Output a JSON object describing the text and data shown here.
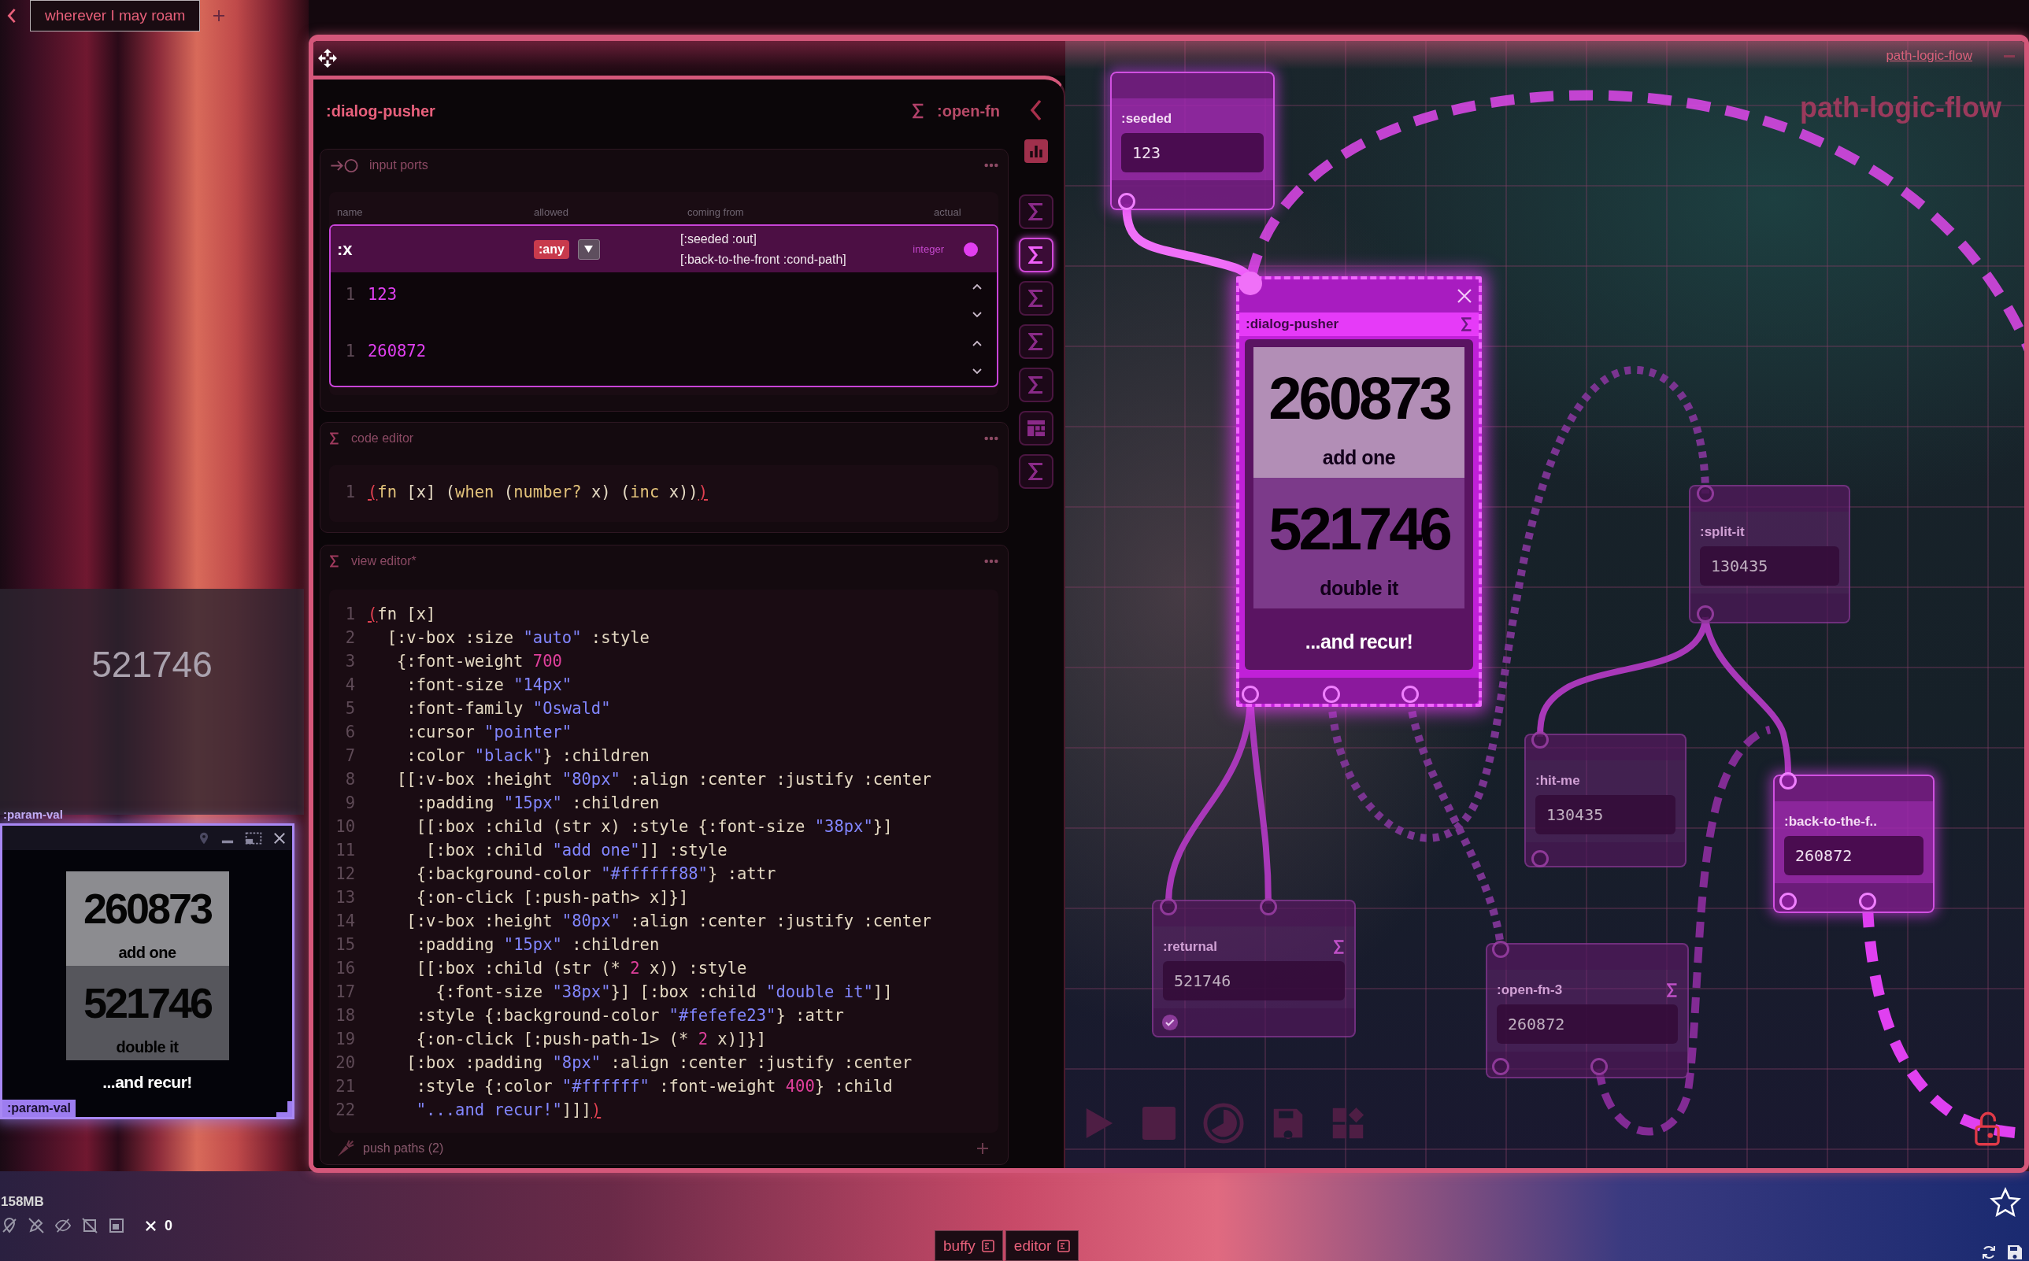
{
  "top_bar": {
    "tabs": [
      {
        "label": "wherever I may roam",
        "selected": true
      }
    ]
  },
  "preview": {
    "value": "521746"
  },
  "param_window": {
    "title": ":param-val",
    "view": {
      "boxes": [
        {
          "value": "260873",
          "caption": "add one"
        },
        {
          "value": "521746",
          "caption": "double it"
        }
      ],
      "footer": "...and recur!"
    },
    "badge": ":param-val"
  },
  "status": {
    "memory": "158MB",
    "error_count": "0"
  },
  "main_window": {
    "link": "path-logic-flow",
    "editor": {
      "title": ":dialog-pusher",
      "fn_name": ":open-fn",
      "side_buttons": [
        {
          "kind": "chart",
          "selected": false
        },
        {
          "kind": "sigma",
          "selected": false
        },
        {
          "kind": "sigma",
          "selected": true
        },
        {
          "kind": "sigma",
          "selected": false
        },
        {
          "kind": "sigma",
          "selected": false
        },
        {
          "kind": "sigma",
          "selected": false
        },
        {
          "kind": "layout",
          "selected": false
        },
        {
          "kind": "sigma",
          "selected": false
        }
      ],
      "input_ports": {
        "title": "input ports",
        "columns": [
          "name",
          "allowed",
          "coming from",
          "actual"
        ],
        "rows": [
          {
            "name": ":x",
            "allowed": ":any",
            "coming_from": [
              "[:seeded :out]",
              "[:back-to-the-front :cond-path]"
            ],
            "actual": "integer",
            "selected": true,
            "values": [
              {
                "line": "1",
                "text": "123"
              },
              {
                "line": "1",
                "text": "260872"
              }
            ]
          }
        ]
      },
      "code_editor": {
        "title": "code editor",
        "lines": [
          {
            "number": "1",
            "tokens": [
              {
                "kind": "match",
                "text": "("
              },
              {
                "kind": "symbol",
                "text": "fn"
              },
              {
                "kind": "plain",
                "text": " [x] ("
              },
              {
                "kind": "symbol",
                "text": "when"
              },
              {
                "kind": "plain",
                "text": " ("
              },
              {
                "kind": "symbol",
                "text": "number?"
              },
              {
                "kind": "plain",
                "text": " x) ("
              },
              {
                "kind": "symbol",
                "text": "inc"
              },
              {
                "kind": "plain",
                "text": " x))"
              },
              {
                "kind": "match",
                "text": ")"
              }
            ]
          }
        ]
      },
      "view_editor": {
        "title": "view editor*",
        "lines": [
          {
            "number": "1",
            "tokens": [
              {
                "kind": "match",
                "text": "("
              },
              {
                "kind": "plain",
                "text": "fn [x]"
              }
            ]
          },
          {
            "number": "2",
            "tokens": [
              {
                "kind": "plain",
                "text": "  [:v-box :size "
              },
              {
                "kind": "string",
                "text": "\"auto\""
              },
              {
                "kind": "plain",
                "text": " :style"
              }
            ]
          },
          {
            "number": "3",
            "tokens": [
              {
                "kind": "plain",
                "text": "   {:font-weight "
              },
              {
                "kind": "number",
                "text": "700"
              }
            ]
          },
          {
            "number": "4",
            "tokens": [
              {
                "kind": "plain",
                "text": "    :font-size "
              },
              {
                "kind": "string",
                "text": "\"14px\""
              }
            ]
          },
          {
            "number": "5",
            "tokens": [
              {
                "kind": "plain",
                "text": "    :font-family "
              },
              {
                "kind": "string",
                "text": "\"Oswald\""
              }
            ]
          },
          {
            "number": "6",
            "tokens": [
              {
                "kind": "plain",
                "text": "    :cursor "
              },
              {
                "kind": "string",
                "text": "\"pointer\""
              }
            ]
          },
          {
            "number": "7",
            "tokens": [
              {
                "kind": "plain",
                "text": "    :color "
              },
              {
                "kind": "string",
                "text": "\"black\""
              },
              {
                "kind": "plain",
                "text": "} :children"
              }
            ]
          },
          {
            "number": "8",
            "tokens": [
              {
                "kind": "plain",
                "text": "   [[:v-box :height "
              },
              {
                "kind": "string",
                "text": "\"80px\""
              },
              {
                "kind": "plain",
                "text": " :align :center :justify :center"
              }
            ]
          },
          {
            "number": "9",
            "tokens": [
              {
                "kind": "plain",
                "text": "     :padding "
              },
              {
                "kind": "string",
                "text": "\"15px\""
              },
              {
                "kind": "plain",
                "text": " :children"
              }
            ]
          },
          {
            "number": "10",
            "tokens": [
              {
                "kind": "plain",
                "text": "     [[:box :child (str x) :style {:font-size "
              },
              {
                "kind": "string",
                "text": "\"38px\""
              },
              {
                "kind": "plain",
                "text": "}]"
              }
            ]
          },
          {
            "number": "11",
            "tokens": [
              {
                "kind": "plain",
                "text": "      [:box :child "
              },
              {
                "kind": "string",
                "text": "\"add one\""
              },
              {
                "kind": "plain",
                "text": "]] :style"
              }
            ]
          },
          {
            "number": "12",
            "tokens": [
              {
                "kind": "plain",
                "text": "     {:background-color "
              },
              {
                "kind": "string",
                "text": "\"#ffffff88\""
              },
              {
                "kind": "plain",
                "text": "} :attr"
              }
            ]
          },
          {
            "number": "13",
            "tokens": [
              {
                "kind": "plain",
                "text": "     {:on-click [:push-path> x]}]"
              }
            ]
          },
          {
            "number": "14",
            "tokens": [
              {
                "kind": "plain",
                "text": "    [:v-box :height "
              },
              {
                "kind": "string",
                "text": "\"80px\""
              },
              {
                "kind": "plain",
                "text": " :align :center :justify :center"
              }
            ]
          },
          {
            "number": "15",
            "tokens": [
              {
                "kind": "plain",
                "text": "     :padding "
              },
              {
                "kind": "string",
                "text": "\"15px\""
              },
              {
                "kind": "plain",
                "text": " :children"
              }
            ]
          },
          {
            "number": "16",
            "tokens": [
              {
                "kind": "plain",
                "text": "     [[:box :child (str (* "
              },
              {
                "kind": "number",
                "text": "2"
              },
              {
                "kind": "plain",
                "text": " x)) :style"
              }
            ]
          },
          {
            "number": "17",
            "tokens": [
              {
                "kind": "plain",
                "text": "       {:font-size "
              },
              {
                "kind": "string",
                "text": "\"38px\""
              },
              {
                "kind": "plain",
                "text": "}] [:box :child "
              },
              {
                "kind": "string",
                "text": "\"double it\""
              },
              {
                "kind": "plain",
                "text": "]]"
              }
            ]
          },
          {
            "number": "18",
            "tokens": [
              {
                "kind": "plain",
                "text": "     :style {:background-color "
              },
              {
                "kind": "string",
                "text": "\"#fefefe23\""
              },
              {
                "kind": "plain",
                "text": "} :attr"
              }
            ]
          },
          {
            "number": "19",
            "tokens": [
              {
                "kind": "plain",
                "text": "     {:on-click [:push-path-1> (* "
              },
              {
                "kind": "number",
                "text": "2"
              },
              {
                "kind": "plain",
                "text": " x)]}]"
              }
            ]
          },
          {
            "number": "20",
            "tokens": [
              {
                "kind": "plain",
                "text": "    [:box :padding "
              },
              {
                "kind": "string",
                "text": "\"8px\""
              },
              {
                "kind": "plain",
                "text": " :align :center :justify :center"
              }
            ]
          },
          {
            "number": "21",
            "tokens": [
              {
                "kind": "plain",
                "text": "     :style {:color "
              },
              {
                "kind": "string",
                "text": "\"#ffffff\""
              },
              {
                "kind": "plain",
                "text": " :font-weight "
              },
              {
                "kind": "number",
                "text": "400"
              },
              {
                "kind": "plain",
                "text": "} :child"
              }
            ]
          },
          {
            "number": "22",
            "tokens": [
              {
                "kind": "string",
                "text": "     \"...and recur!\""
              },
              {
                "kind": "plain",
                "text": "]]]"
              },
              {
                "kind": "match",
                "text": ")"
              }
            ]
          }
        ]
      },
      "push_paths": {
        "title": "push paths (2)"
      }
    },
    "flow": {
      "title": "path-logic-flow",
      "nodes": [
        {
          "label": ":seeded",
          "kind": "value",
          "value": "123",
          "active": true,
          "selected": false,
          "done": false
        },
        {
          "label": ":dialog-pusher",
          "kind": "view",
          "view": {
            "boxes": [
              {
                "value": "260873",
                "caption": "add one"
              },
              {
                "value": "521746",
                "caption": "double it"
              }
            ],
            "footer": "...and recur!"
          },
          "active": true,
          "selected": true,
          "done": false
        },
        {
          "label": ":split-it",
          "kind": "value",
          "value": "130435",
          "active": false,
          "selected": false,
          "done": false
        },
        {
          "label": ":hit-me",
          "kind": "value",
          "value": "130435",
          "active": false,
          "selected": false,
          "done": false
        },
        {
          "label": ":back-to-the-f..",
          "kind": "value",
          "value": "260872",
          "active": true,
          "selected": false,
          "done": false
        },
        {
          "label": ":returnal",
          "kind": "fn",
          "value": "521746",
          "active": false,
          "selected": false,
          "done": true
        },
        {
          "label": ":open-fn-3",
          "kind": "fn",
          "value": "260872",
          "active": false,
          "selected": false,
          "done": false
        }
      ]
    }
  },
  "taskbar": {
    "tabs": [
      {
        "label": "buffy"
      },
      {
        "label": "editor"
      }
    ]
  }
}
